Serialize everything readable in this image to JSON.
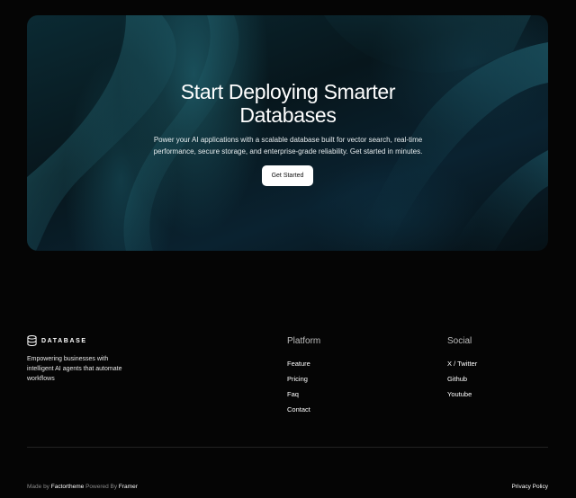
{
  "hero": {
    "title_line1": "Start Deploying Smarter",
    "title_line2": "Databases",
    "subtitle_line1": "Power your AI applications with a scalable database built for vector search, real-time",
    "subtitle_line2": "performance, secure storage, and enterprise-grade reliability. Get started in minutes.",
    "cta_label": "Get Started"
  },
  "footer": {
    "brand": {
      "icon": "database-icon",
      "name": "DATABASE",
      "desc_line1": "Empowering businesses with",
      "desc_line2": "intelligent AI agents that automate",
      "desc_line3": "workflows"
    },
    "platform": {
      "heading": "Platform",
      "links": [
        "Feature",
        "Pricing",
        "Faq",
        "Contact"
      ]
    },
    "social": {
      "heading": "Social",
      "links": [
        "X / Twitter",
        "Github",
        "Youtube"
      ]
    },
    "bottom": {
      "made_by_prefix": "Made by",
      "made_by_name": "Factortheme",
      "powered_prefix": "Powered By",
      "powered_name": "Framer",
      "policy": "Privacy Policy"
    }
  },
  "colors": {
    "background": "#050505",
    "hero_teal": "#1f6f7d",
    "button_bg": "#ffffff",
    "muted_text": "#8a8a8a"
  }
}
